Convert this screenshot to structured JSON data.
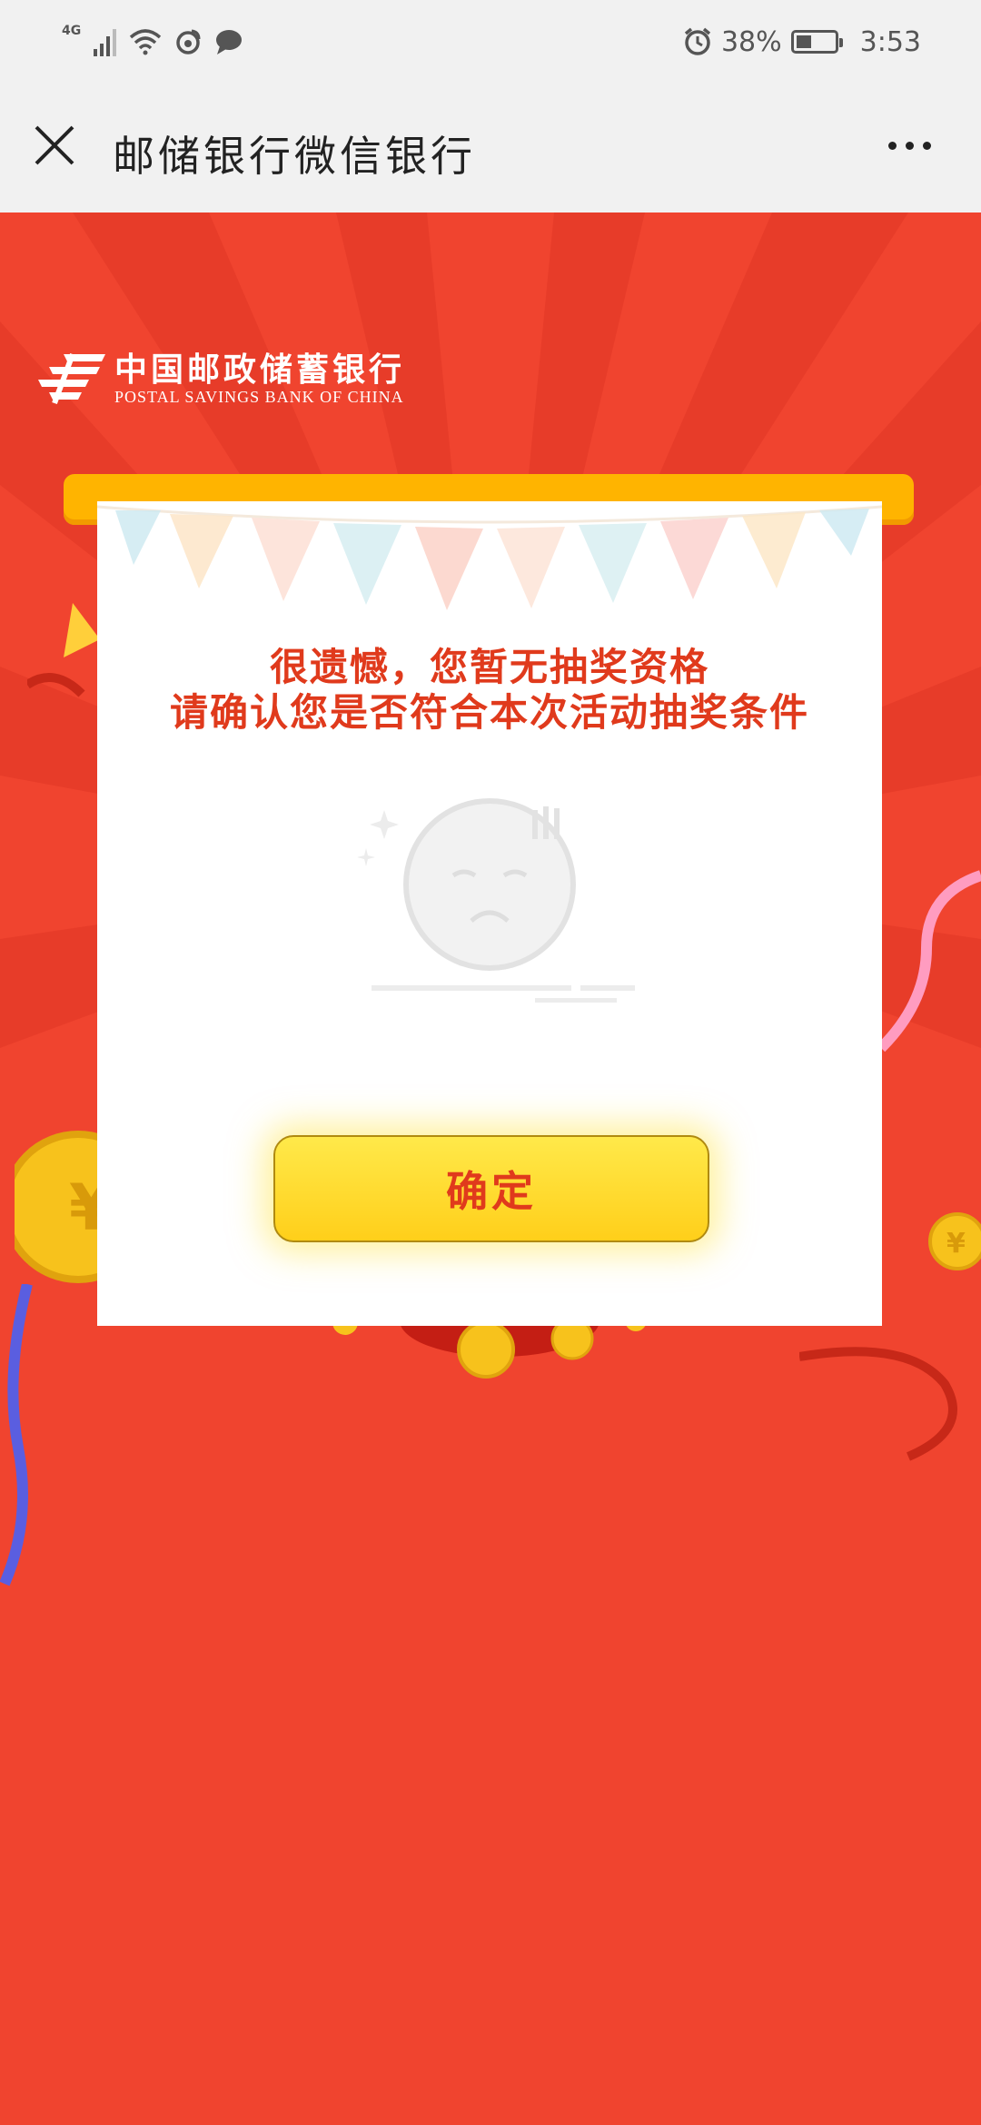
{
  "status_bar": {
    "network": "4G",
    "battery_percent": "38%",
    "time": "3:53",
    "icons": [
      "signal-icon",
      "wifi-icon",
      "weibo-icon",
      "chat-icon",
      "alarm-icon",
      "battery-icon"
    ]
  },
  "title_bar": {
    "title": "邮储银行微信银行",
    "close_icon": "close-icon",
    "more_icon": "more-icon"
  },
  "logo": {
    "name_cn": "中国邮政储蓄银行",
    "name_en": "POSTAL SAVINGS BANK OF CHINA"
  },
  "dialog": {
    "line1": "很遗憾，您暂无抽奖资格",
    "line2": "请确认您是否符合本次活动抽奖条件",
    "illustration": "sad-face-icon",
    "confirm_label": "确定"
  },
  "colors": {
    "background": "#f0442f",
    "accent_text": "#e03a1c",
    "button": "#ffd92e",
    "bar": "#ffb400"
  }
}
